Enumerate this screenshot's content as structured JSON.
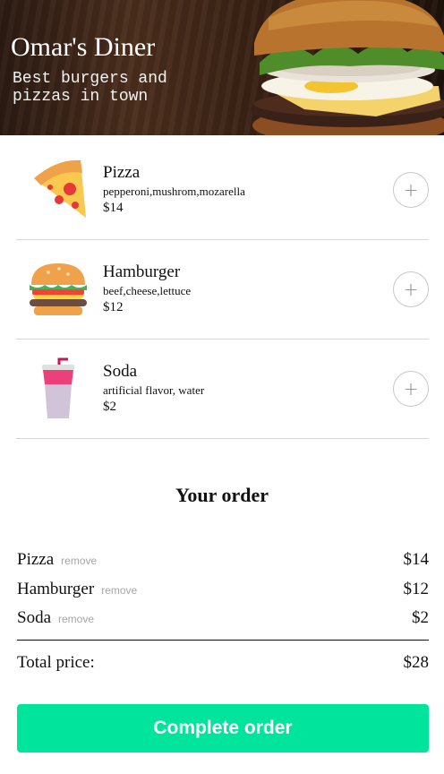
{
  "header": {
    "title": "Omar's Diner",
    "subtitle": "Best burgers and pizzas in town"
  },
  "menu": {
    "items": [
      {
        "name": "Pizza",
        "description": "pepperoni,mushrom,mozarella",
        "price": "$14",
        "icon": "pizza-slice-icon",
        "add_symbol": "+"
      },
      {
        "name": "Hamburger",
        "description": "beef,cheese,lettuce",
        "price": "$12",
        "icon": "hamburger-icon",
        "add_symbol": "+"
      },
      {
        "name": "Soda",
        "description": "artificial flavor, water",
        "price": "$2",
        "icon": "soda-cup-icon",
        "add_symbol": "+"
      }
    ]
  },
  "order": {
    "title": "Your order",
    "items": [
      {
        "name": "Pizza",
        "remove_label": "remove",
        "price": "$14"
      },
      {
        "name": "Hamburger",
        "remove_label": "remove",
        "price": "$12"
      },
      {
        "name": "Soda",
        "remove_label": "remove",
        "price": "$2"
      }
    ],
    "total_label": "Total price:",
    "total_value": "$28",
    "complete_label": "Complete order"
  },
  "colors": {
    "accent": "#00e59b",
    "remove_text": "#a6a6a6",
    "divider": "#d8d8d8"
  }
}
